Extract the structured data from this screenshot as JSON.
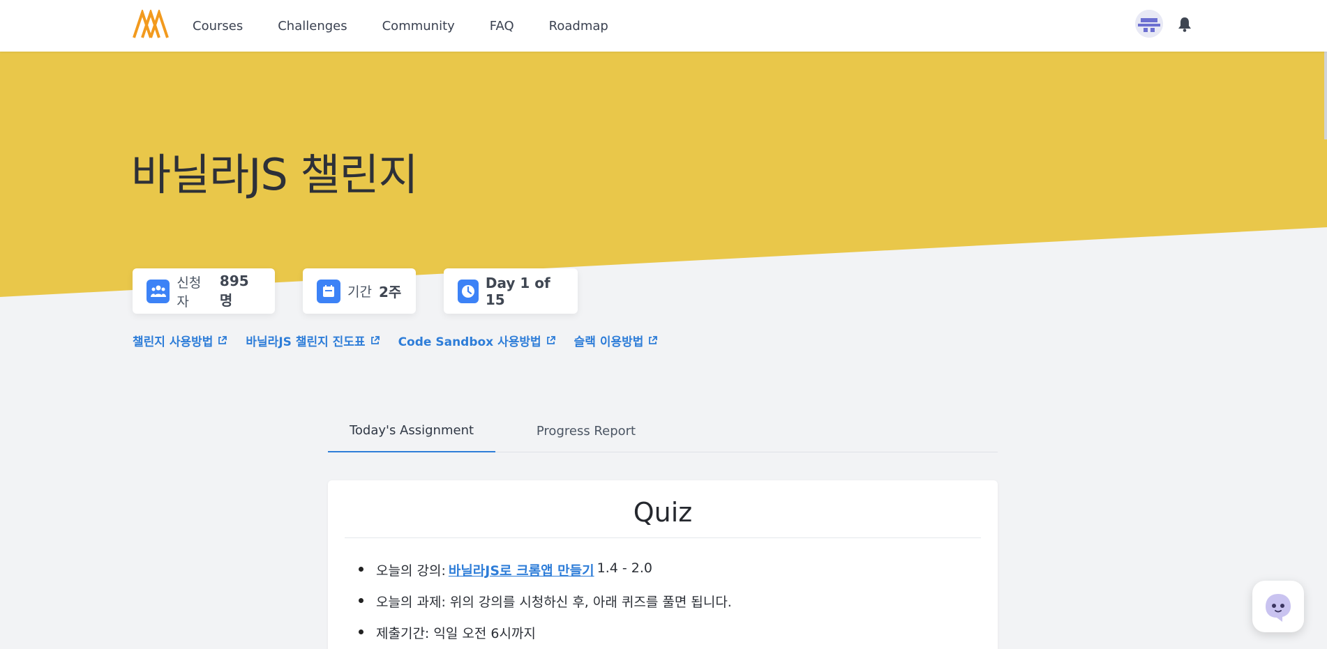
{
  "nav": {
    "links": [
      "Courses",
      "Challenges",
      "Community",
      "FAQ",
      "Roadmap"
    ]
  },
  "hero": {
    "title": "바닐라JS 챌린지",
    "color": "#e9c74a"
  },
  "stats": {
    "applicants_label": "신청자",
    "applicants_value": "895명",
    "duration_label": "기간",
    "duration_value": "2주",
    "day_value": "Day 1 of 15"
  },
  "links": [
    "챌린지 사용방법",
    "바닐라JS 챌린지 진도표",
    "Code Sandbox 사용방법",
    "슬랙 이용방법"
  ],
  "tabs": [
    "Today's Assignment",
    "Progress Report"
  ],
  "quiz": {
    "title": "Quiz",
    "lecture_prefix": "오늘의 강의:",
    "lecture_link": "바닐라JS로 크롬앱 만들기",
    "lecture_suffix": "1.4 - 2.0",
    "assignment": "오늘의 과제: 위의 강의를 시청하신 후, 아래 퀴즈를 풀면 됩니다.",
    "deadline": "제출기간: 익일 오전 6시까지"
  },
  "colors": {
    "accent": "#2e7dd8",
    "icon_bg": "#3c82f6",
    "logo": "#f29a1e"
  }
}
